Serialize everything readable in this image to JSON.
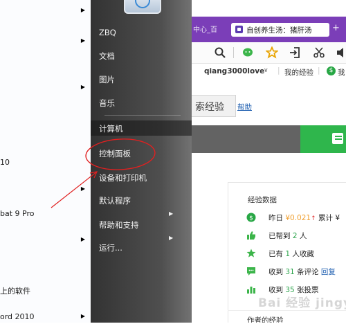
{
  "left_programs": {
    "items": [
      {
        "label": "",
        "has_arrow": true
      },
      {
        "label": "",
        "has_arrow": true
      },
      {
        "label": "",
        "has_arrow": true
      },
      {
        "label": "10",
        "has_arrow": false
      },
      {
        "label": "",
        "has_arrow": true
      },
      {
        "label": "bat 9 Pro",
        "has_arrow": false
      },
      {
        "label": "",
        "has_arrow": true
      },
      {
        "label": "上的软件",
        "has_arrow": false
      },
      {
        "label": "ord 2010",
        "has_arrow": true
      }
    ]
  },
  "start_menu": {
    "items": [
      {
        "label": "ZBQ"
      },
      {
        "label": "文档"
      },
      {
        "label": "图片"
      },
      {
        "label": "音乐"
      },
      {
        "label": "计算机"
      },
      {
        "label": "控制面板"
      },
      {
        "label": "设备和打印机"
      },
      {
        "label": "默认程序"
      },
      {
        "label": "帮助和支持"
      },
      {
        "label": "运行..."
      }
    ]
  },
  "browser": {
    "tab_ghost_text": "中心_百",
    "active_tab_title": "自创养生汤：猪肝汤",
    "tab_close": "+",
    "username": "qiang3000love",
    "user_chevron": "∨",
    "my_experience": "我的经验",
    "coin_symbol": "$",
    "me_label": "我",
    "search_button": "搜索经验",
    "search_button_visible": "索经验",
    "help_link": "帮助",
    "panel": {
      "title": "经验数据",
      "rows": [
        {
          "icon": "coin-icon",
          "prefix": "昨日",
          "amount": "¥0.021",
          "suffix": "累计 ¥"
        },
        {
          "icon": "thumb-icon",
          "prefix": "已帮到",
          "count": "2",
          "suffix": "人"
        },
        {
          "icon": "star-icon",
          "prefix": "已有",
          "count": "1",
          "suffix": "人收藏"
        },
        {
          "icon": "comment-icon",
          "prefix": "收到",
          "count": "31",
          "suffix": "条评论",
          "link": "回复"
        },
        {
          "icon": "bar-icon",
          "prefix": "收到",
          "count": "35",
          "suffix": "张投票"
        }
      ]
    },
    "author_label": "作者的经验",
    "watermark": "Bai 经验 jingyan"
  },
  "colors": {
    "tab_purple": "#7b3eb8",
    "action_green": "#2fb64c",
    "nav_gray": "#636363",
    "annotation_red": "#e02020"
  }
}
